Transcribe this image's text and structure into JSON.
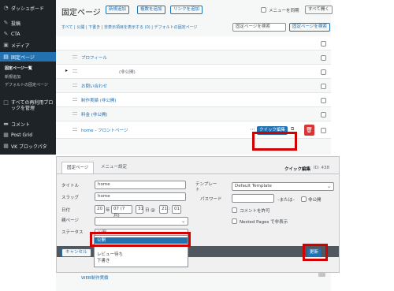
{
  "sidebar": {
    "items": [
      {
        "label": "ダッシュボード",
        "icon": "gauge-icon"
      },
      {
        "label": "投稿",
        "icon": "pin-icon"
      },
      {
        "label": "CTA",
        "icon": "pin-icon"
      },
      {
        "label": "メディア",
        "icon": "media-icon"
      },
      {
        "label": "固定ページ",
        "icon": "page-icon"
      },
      {
        "label": "すべての再利用ブロックを管理",
        "icon": "block-icon"
      },
      {
        "label": "コメント",
        "icon": "comment-icon"
      },
      {
        "label": "Post Grid",
        "icon": "grid-icon"
      },
      {
        "label": "VK ブロックパタ",
        "icon": "grid-icon"
      }
    ],
    "subitems": [
      "固定ページ一覧",
      "新規追加",
      "デフォルトの固定ページ"
    ]
  },
  "header": {
    "title": "固定ページ",
    "buttons": [
      "新規追加",
      "複数を追加",
      "リンクを追加"
    ],
    "menu_display_label": "メニューを同期",
    "all_label": "すべて開く"
  },
  "filters": {
    "text": "すべて | 公開 | 下書き | 非表示項目を表示する (0) | デフォルトの固定ページ",
    "search_placeholder": "固定ページを検索",
    "search_button": "固定ページを検索"
  },
  "rows": [
    {
      "title": "プロフィール"
    },
    {
      "title": "(非公開)"
    },
    {
      "title": "お問い合わせ"
    },
    {
      "title": "制作実績 (非公開)"
    },
    {
      "title": "料金 (非公開)"
    },
    {
      "title": "home - フロントページ"
    }
  ],
  "quick_edit_button": "クイック編集",
  "modal": {
    "tabs": [
      "固定ページ",
      "メニュー設定"
    ],
    "heading": "クイック編集",
    "id_label": "ID: 438",
    "fields": {
      "title_label": "タイトル",
      "title_value": "home",
      "slug_label": "スラッグ",
      "slug_value": "home",
      "date_label": "日付",
      "date_year": "20",
      "date_year_unit": "年",
      "date_month": "07 (7月)",
      "date_day": "31",
      "date_day_unit": "日 @",
      "date_hour": "21",
      "date_min": "01",
      "password_label": "パスワード",
      "parent_label": "親ページ",
      "status_label": "ステータス",
      "status_value": "公開",
      "template_label": "テンプレート",
      "template_value": "Default Template",
      "or_label": "–または–",
      "private_label": "非公開",
      "allow_comments_label": "コメントを許可",
      "nested_label": "Nested Pages で非表示"
    },
    "dropdown_options": [
      "公開",
      "レビュー待ち",
      "下書き"
    ],
    "cancel_label": "キャンセル",
    "update_label": "更新"
  },
  "bottom_row_title": "WEB制作実績",
  "colors": {
    "accent": "#2271b1",
    "highlight": "#d20000",
    "sidebar": "#1d2327"
  }
}
